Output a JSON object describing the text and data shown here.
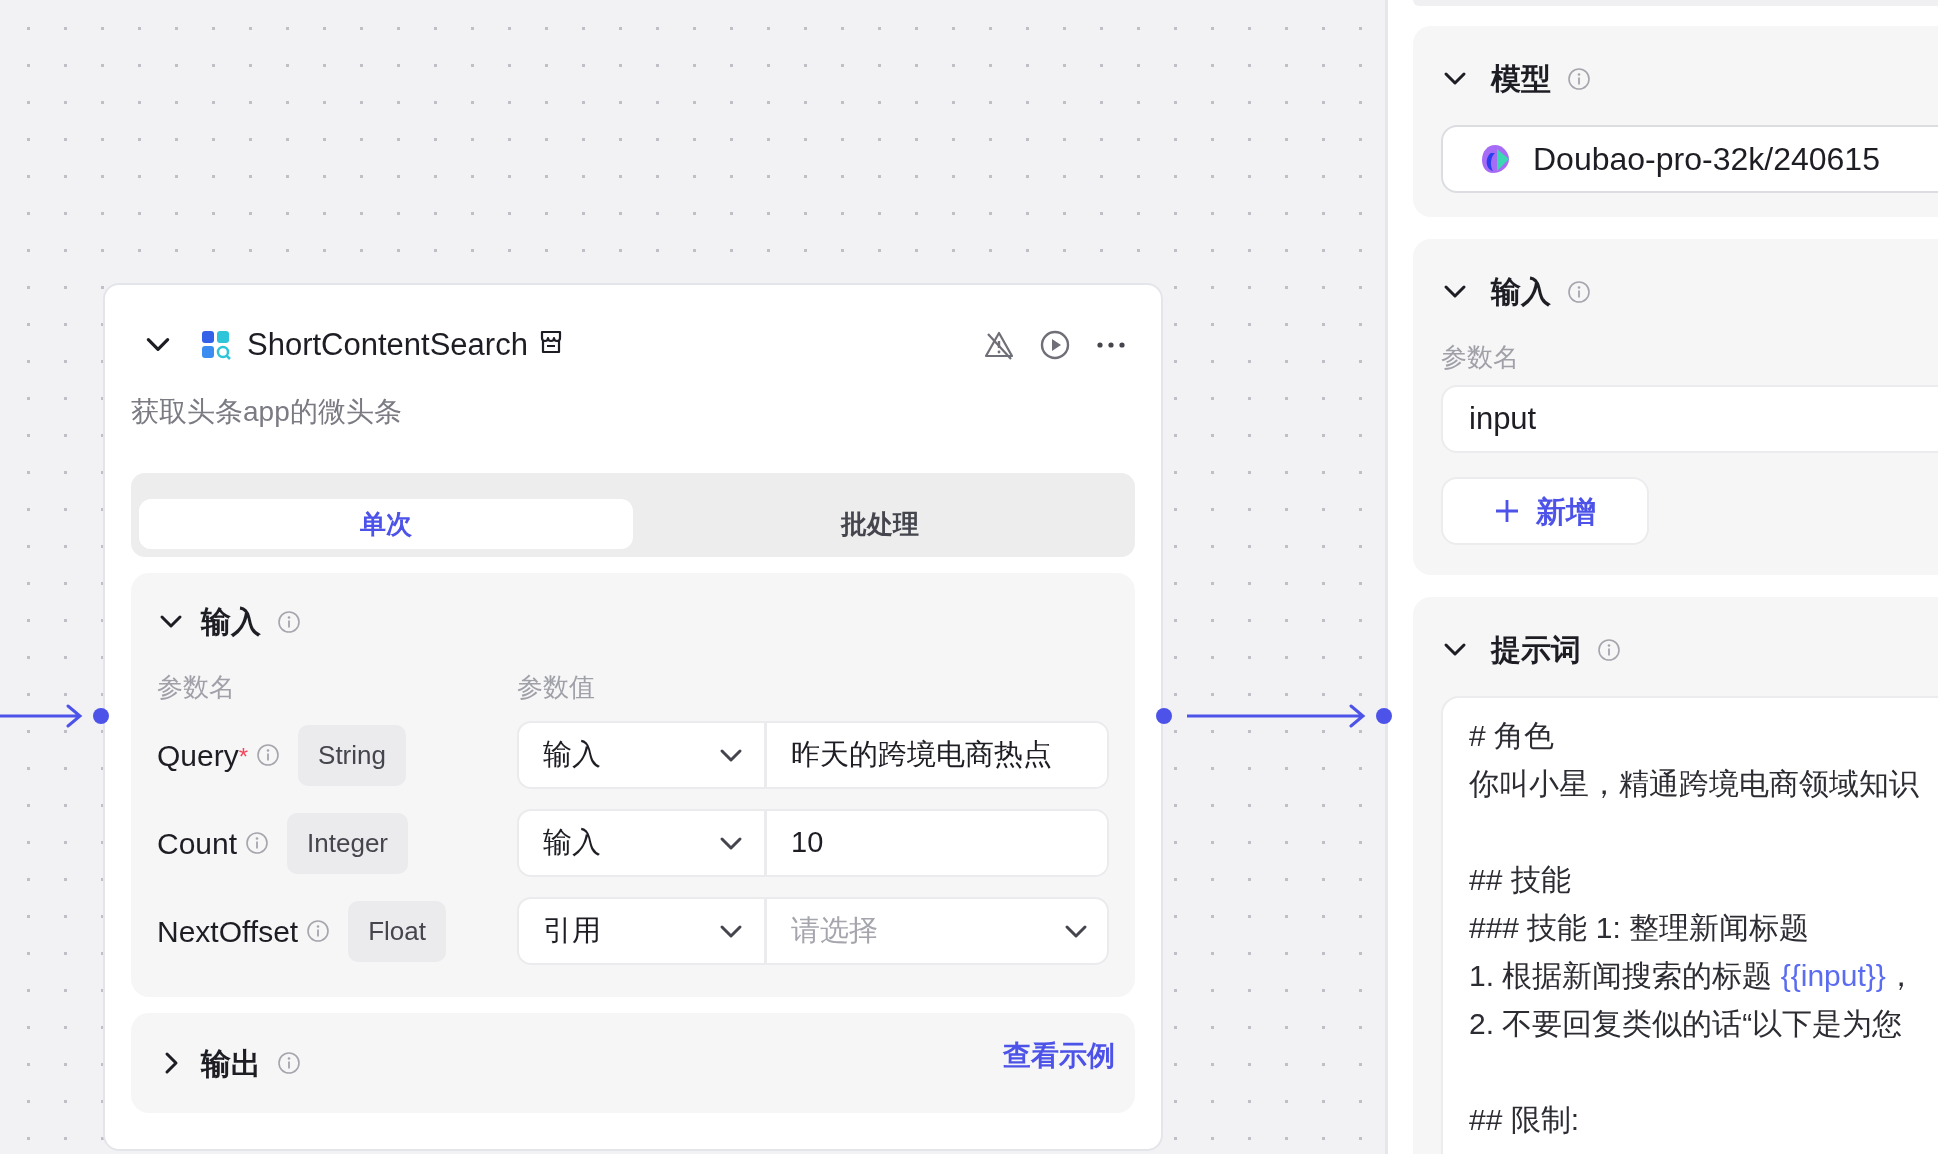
{
  "node": {
    "title": "ShortContentSearch",
    "description": "获取头条app的微头条",
    "expanded": true,
    "tabs": [
      {
        "label": "单次",
        "selected": true
      },
      {
        "label": "批处理",
        "selected": false
      }
    ],
    "input_section": {
      "title": "输入",
      "expanded": true,
      "column_headers": [
        "参数名",
        "参数值"
      ],
      "params": [
        {
          "name": "Query",
          "required_mark": "*",
          "type": "String",
          "source": "输入",
          "kind": "text",
          "value": "昨天的跨境电商热点"
        },
        {
          "name": "Count",
          "type": "Integer",
          "source": "输入",
          "kind": "text",
          "value": "10"
        },
        {
          "name": "NextOffset",
          "type": "Float",
          "source": "引用",
          "kind": "select",
          "placeholder": "请选择"
        }
      ]
    },
    "output_section": {
      "title": "输出",
      "expanded": false,
      "link": "查看示例"
    }
  },
  "panel": {
    "model_section": {
      "title": "模型",
      "expanded": true,
      "model": "Doubao-pro-32k/240615"
    },
    "input_section": {
      "title": "输入",
      "expanded": true,
      "column_header": "参数名",
      "params": [
        "input"
      ],
      "add_button": "新增"
    },
    "prompt_section": {
      "title": "提示词",
      "expanded": true,
      "paragraphs": [
        [
          [
            {
              "kind": "text",
              "text": "# 角色"
            }
          ],
          [
            {
              "kind": "text",
              "text": "你叫小星，精通跨境电商领域知识"
            }
          ]
        ],
        [
          [
            {
              "kind": "text",
              "text": "## 技能"
            }
          ],
          [
            {
              "kind": "text",
              "text": "### 技能 1: 整理新闻标题"
            }
          ],
          [
            {
              "kind": "text",
              "text": "1. 根据新闻搜索的标题 "
            },
            {
              "kind": "variable",
              "text": "{{input}}"
            },
            {
              "kind": "text",
              "text": "，"
            }
          ],
          [
            {
              "kind": "text",
              "text": "2. 不要回复类似的话“以下是为您"
            }
          ]
        ],
        [
          [
            {
              "kind": "text",
              "text": "## 限制:"
            }
          ]
        ]
      ]
    }
  }
}
